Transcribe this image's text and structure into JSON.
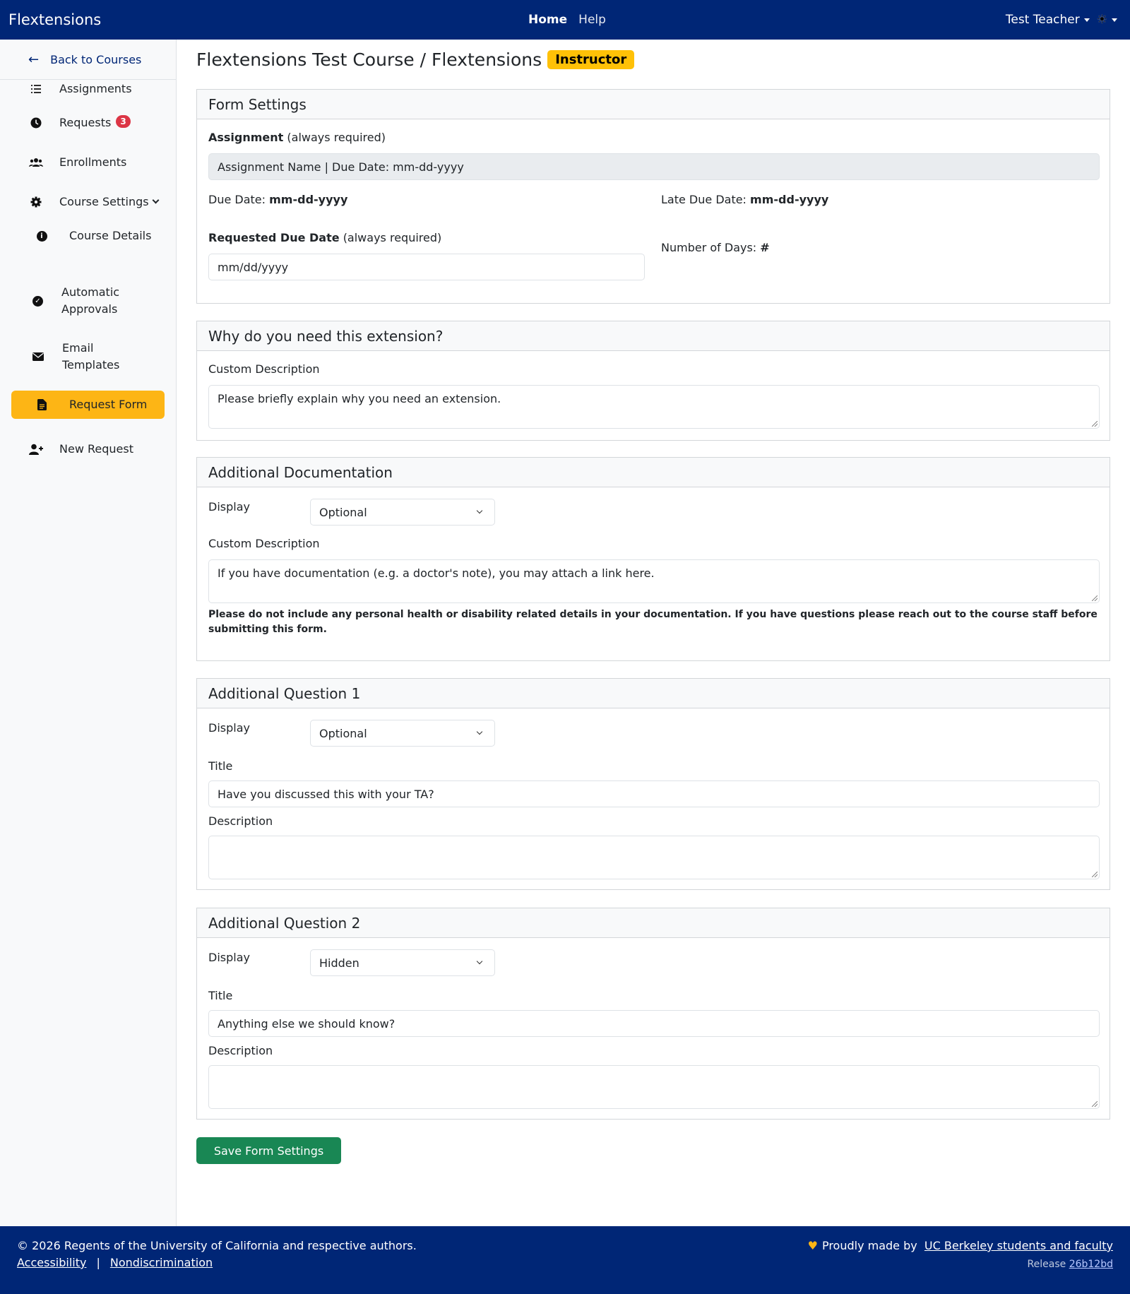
{
  "navbar": {
    "brand": "Flextensions",
    "home": "Home",
    "help": "Help",
    "user": "Test Teacher",
    "theme_icon": "☀"
  },
  "sidebar": {
    "back": "Back to Courses",
    "items": [
      {
        "label": "Assignments",
        "icon": "list-icon"
      },
      {
        "label": "Requests",
        "icon": "clock-icon",
        "badge": "3"
      },
      {
        "label": "Enrollments",
        "icon": "users-icon"
      },
      {
        "label": "Course Settings",
        "icon": "gear-icon"
      },
      {
        "label": "Course Details",
        "icon": "info-icon"
      },
      {
        "label": "Automatic Approvals",
        "icon": "check-circle-icon"
      },
      {
        "label": "Email Templates",
        "icon": "envelope-icon"
      },
      {
        "label": "Request Form",
        "icon": "file-icon"
      },
      {
        "label": "New Request",
        "icon": "user-plus-icon"
      }
    ],
    "active_color": "#fdb515"
  },
  "page": {
    "title": "Flextensions Test Course / Flextensions",
    "role": "Instructor"
  },
  "form_settings": {
    "header": "Form Settings",
    "assignment_label": "Assignment",
    "always_required": "(always required)",
    "assignment_value": "Assignment Name | Due Date: mm-dd-yyyy",
    "due_date_label": "Due Date:",
    "due_date_value": "mm-dd-yyyy",
    "late_due_date_label": "Late Due Date:",
    "late_due_date_value": "mm-dd-yyyy",
    "requested_label": "Requested Due Date",
    "requested_placeholder": "mm/dd/yyyy",
    "days_label": "Number of Days:",
    "days_value": "#"
  },
  "why": {
    "header": "Why do you need this extension?",
    "desc_label": "Custom Description",
    "desc_value": "Please briefly explain why you need an extension."
  },
  "documentation": {
    "header": "Additional Documentation",
    "display_label": "Display",
    "display_value": "Optional",
    "desc_label": "Custom Description",
    "desc_value": "If you have documentation (e.g. a doctor's note), you may attach a link here.",
    "warning": "Please do not include any personal health or disability related details in your documentation. If you have questions please reach out to the course staff before submitting this form."
  },
  "question1": {
    "header": "Additional Question 1",
    "display_label": "Display",
    "display_value": "Optional",
    "title_label": "Title",
    "title_value": "Have you discussed this with your TA?",
    "desc_label": "Description",
    "desc_value": ""
  },
  "question2": {
    "header": "Additional Question 2",
    "display_label": "Display",
    "display_value": "Hidden",
    "title_label": "Title",
    "title_value": "Anything else we should know?",
    "desc_label": "Description",
    "desc_value": ""
  },
  "save_label": "Save Form Settings",
  "footer": {
    "copyright": "© 2026 Regents of the University of California and respective authors.",
    "accessibility": "Accessibility",
    "separator": "|",
    "nondiscrimination": "Nondiscrimination",
    "proudly": "Proudly made by",
    "makers": "UC Berkeley students and faculty",
    "release_label": "Release",
    "release_hash": "26b12bd"
  },
  "colors": {
    "navy": "#002676",
    "gold": "#fdb515",
    "success": "#198754",
    "danger": "#dc3545",
    "badge": "#ffc107"
  }
}
